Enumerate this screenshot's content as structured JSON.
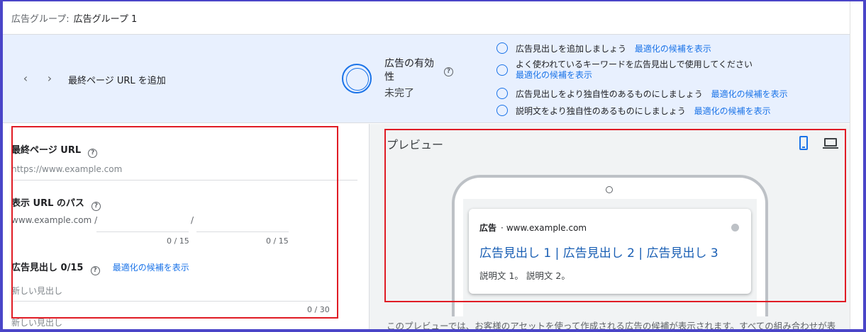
{
  "header": {
    "label": "広告グループ:",
    "value": "広告グループ 1"
  },
  "banner": {
    "prev_icon": "chevron-left-icon",
    "next_icon": "chevron-right-icon",
    "title": "最終ページ URL を追加",
    "strength_label": "広告の有効性",
    "strength_status": "未完了",
    "suggestions": [
      {
        "text": "広告見出しを追加しましょう",
        "link": "最適化の候補を表示"
      },
      {
        "text": "よく使われているキーワードを広告見出しで使用してください",
        "link": "最適化の候補を表示"
      },
      {
        "text": "広告見出しをより独自性のあるものにしましょう",
        "link": "最適化の候補を表示"
      },
      {
        "text": "説明文をより独自性のあるものにしましょう",
        "link": "最適化の候補を表示"
      }
    ]
  },
  "form": {
    "final_url": {
      "label": "最終ページ URL",
      "placeholder": "https://www.example.com"
    },
    "display_path": {
      "label": "表示 URL のパス",
      "prefix": "www.example.com /",
      "separator": "/",
      "counter1": "0 / 15",
      "counter2": "0 / 15"
    },
    "headlines": {
      "label": "広告見出し 0/15",
      "link": "最適化の候補を表示",
      "placeholder1": "新しい見出し",
      "counter1": "0 / 30",
      "placeholder2": "新しい見出し"
    }
  },
  "preview": {
    "title": "プレビュー",
    "ad_badge": "広告",
    "ad_url": "www.example.com",
    "headline": "広告見出し 1 | 広告見出し 2 | 広告見出し 3",
    "description": "説明文 1。 説明文 2。",
    "note": "このプレビューでは、お客様のアセットを使って作成される広告の候補が表示されます。すべての組み合わせが表"
  },
  "colors": {
    "accent": "#1a73e8",
    "banner_bg": "#e8f0fe",
    "highlight": "#e01b24",
    "frame": "#4a45c8"
  }
}
